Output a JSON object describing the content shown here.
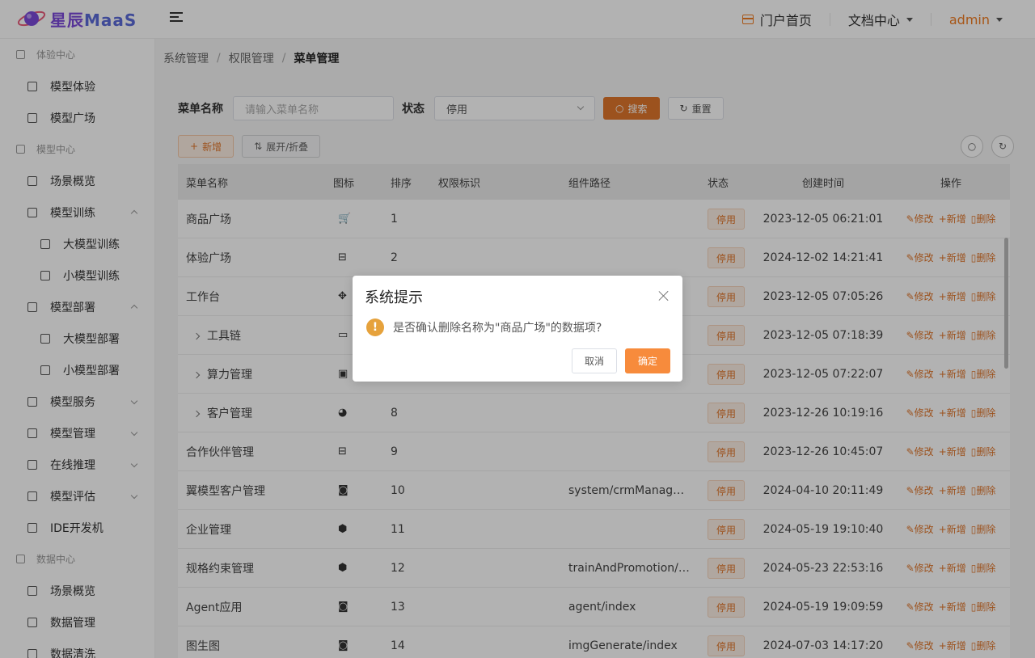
{
  "header": {
    "logo_text_a": "星辰",
    "logo_text_b": "MaaS",
    "portal": "门户首页",
    "docs": "文档中心",
    "user": "admin"
  },
  "sidebar": {
    "sections": [
      {
        "kind": "group",
        "label": "体验中心",
        "icon": "cube-icon"
      },
      {
        "kind": "item",
        "label": "模型体验",
        "icon": "flow-icon"
      },
      {
        "kind": "item",
        "label": "模型广场",
        "icon": "box-icon"
      },
      {
        "kind": "group",
        "label": "模型中心",
        "icon": "cube-icon"
      },
      {
        "kind": "item",
        "label": "场景概览",
        "icon": "flow-icon"
      },
      {
        "kind": "item",
        "label": "模型训练",
        "icon": "train-icon",
        "arrow": "up"
      },
      {
        "kind": "sub",
        "label": "大模型训练",
        "icon": "chip-icon"
      },
      {
        "kind": "sub",
        "label": "小模型训练",
        "icon": "chip-icon"
      },
      {
        "kind": "item",
        "label": "模型部署",
        "icon": "deploy-icon",
        "arrow": "up"
      },
      {
        "kind": "sub",
        "label": "大模型部署",
        "icon": "chip-icon"
      },
      {
        "kind": "sub",
        "label": "小模型部署",
        "icon": "chip-icon"
      },
      {
        "kind": "item",
        "label": "模型服务",
        "icon": "server-icon",
        "arrow": "down"
      },
      {
        "kind": "item",
        "label": "模型管理",
        "icon": "manage-icon",
        "arrow": "down"
      },
      {
        "kind": "item",
        "label": "在线推理",
        "icon": "infer-icon",
        "arrow": "down"
      },
      {
        "kind": "item",
        "label": "模型评估",
        "icon": "eval-icon",
        "arrow": "down"
      },
      {
        "kind": "item",
        "label": "IDE开发机",
        "icon": "ide-icon"
      },
      {
        "kind": "group",
        "label": "数据中心",
        "icon": "db-icon"
      },
      {
        "kind": "item",
        "label": "场景概览",
        "icon": "flow-icon"
      },
      {
        "kind": "item",
        "label": "数据管理",
        "icon": "pie-icon"
      },
      {
        "kind": "item",
        "label": "数据清洗",
        "icon": "grid-icon"
      }
    ]
  },
  "breadcrumb": [
    "系统管理",
    "权限管理",
    "菜单管理"
  ],
  "search": {
    "name_label": "菜单名称",
    "name_placeholder": "请输入菜单名称",
    "status_label": "状态",
    "status_value": "停用",
    "search_btn": "搜索",
    "reset_btn": "重置"
  },
  "toolbar": {
    "add_btn": "新增",
    "expand_btn": "展开/折叠"
  },
  "table": {
    "columns": [
      "菜单名称",
      "图标",
      "排序",
      "权限标识",
      "组件路径",
      "状态",
      "创建时间",
      "操作"
    ],
    "ops": [
      "修改",
      "新增",
      "删除"
    ],
    "rows": [
      {
        "name": "商品广场",
        "expandable": false,
        "icon": "🛒",
        "order": "1",
        "perm": "",
        "path": "",
        "status": "停用",
        "time": "2023-12-05 06:21:01"
      },
      {
        "name": "体验广场",
        "expandable": false,
        "icon": "⊟",
        "order": "2",
        "perm": "",
        "path": "",
        "status": "停用",
        "time": "2024-12-02 14:21:41"
      },
      {
        "name": "工作台",
        "expandable": false,
        "icon": "✥",
        "order": "",
        "perm": "",
        "path": "",
        "status": "停用",
        "time": "2023-12-05 07:05:26"
      },
      {
        "name": "工具链",
        "expandable": true,
        "icon": "▭",
        "order": "",
        "perm": "",
        "path": "",
        "status": "停用",
        "time": "2023-12-05 07:18:39"
      },
      {
        "name": "算力管理",
        "expandable": true,
        "icon": "▣",
        "order": "",
        "perm": "",
        "path": "",
        "status": "停用",
        "time": "2023-12-05 07:22:07"
      },
      {
        "name": "客户管理",
        "expandable": true,
        "icon": "◕",
        "order": "8",
        "perm": "",
        "path": "",
        "status": "停用",
        "time": "2023-12-26 10:19:16"
      },
      {
        "name": "合作伙伴管理",
        "expandable": false,
        "icon": "⊟",
        "order": "9",
        "perm": "",
        "path": "",
        "status": "停用",
        "time": "2023-12-26 10:45:07"
      },
      {
        "name": "翼模型客户管理",
        "expandable": false,
        "icon": "◙",
        "order": "10",
        "perm": "",
        "path": "system/crmManage…",
        "status": "停用",
        "time": "2024-04-10 20:11:49"
      },
      {
        "name": "企业管理",
        "expandable": false,
        "icon": "⬢",
        "order": "11",
        "perm": "",
        "path": "",
        "status": "停用",
        "time": "2024-05-19 19:10:40"
      },
      {
        "name": "规格约束管理",
        "expandable": false,
        "icon": "⬢",
        "order": "12",
        "perm": "",
        "path": "trainAndPromotion/c…",
        "status": "停用",
        "time": "2024-05-23 22:53:16"
      },
      {
        "name": "Agent应用",
        "expandable": false,
        "icon": "◙",
        "order": "13",
        "perm": "",
        "path": "agent/index",
        "status": "停用",
        "time": "2024-05-19 19:09:59"
      },
      {
        "name": "图生图",
        "expandable": false,
        "icon": "◙",
        "order": "14",
        "perm": "",
        "path": "imgGenerate/index",
        "status": "停用",
        "time": "2024-07-03 14:17:20"
      }
    ]
  },
  "dialog": {
    "title": "系统提示",
    "message": "是否确认删除名称为\"商品广场\"的数据项?",
    "cancel": "取消",
    "confirm": "确定"
  },
  "colors": {
    "accent": "#e0762b",
    "confirm": "#f78b3c",
    "warning": "#e6a23c"
  }
}
